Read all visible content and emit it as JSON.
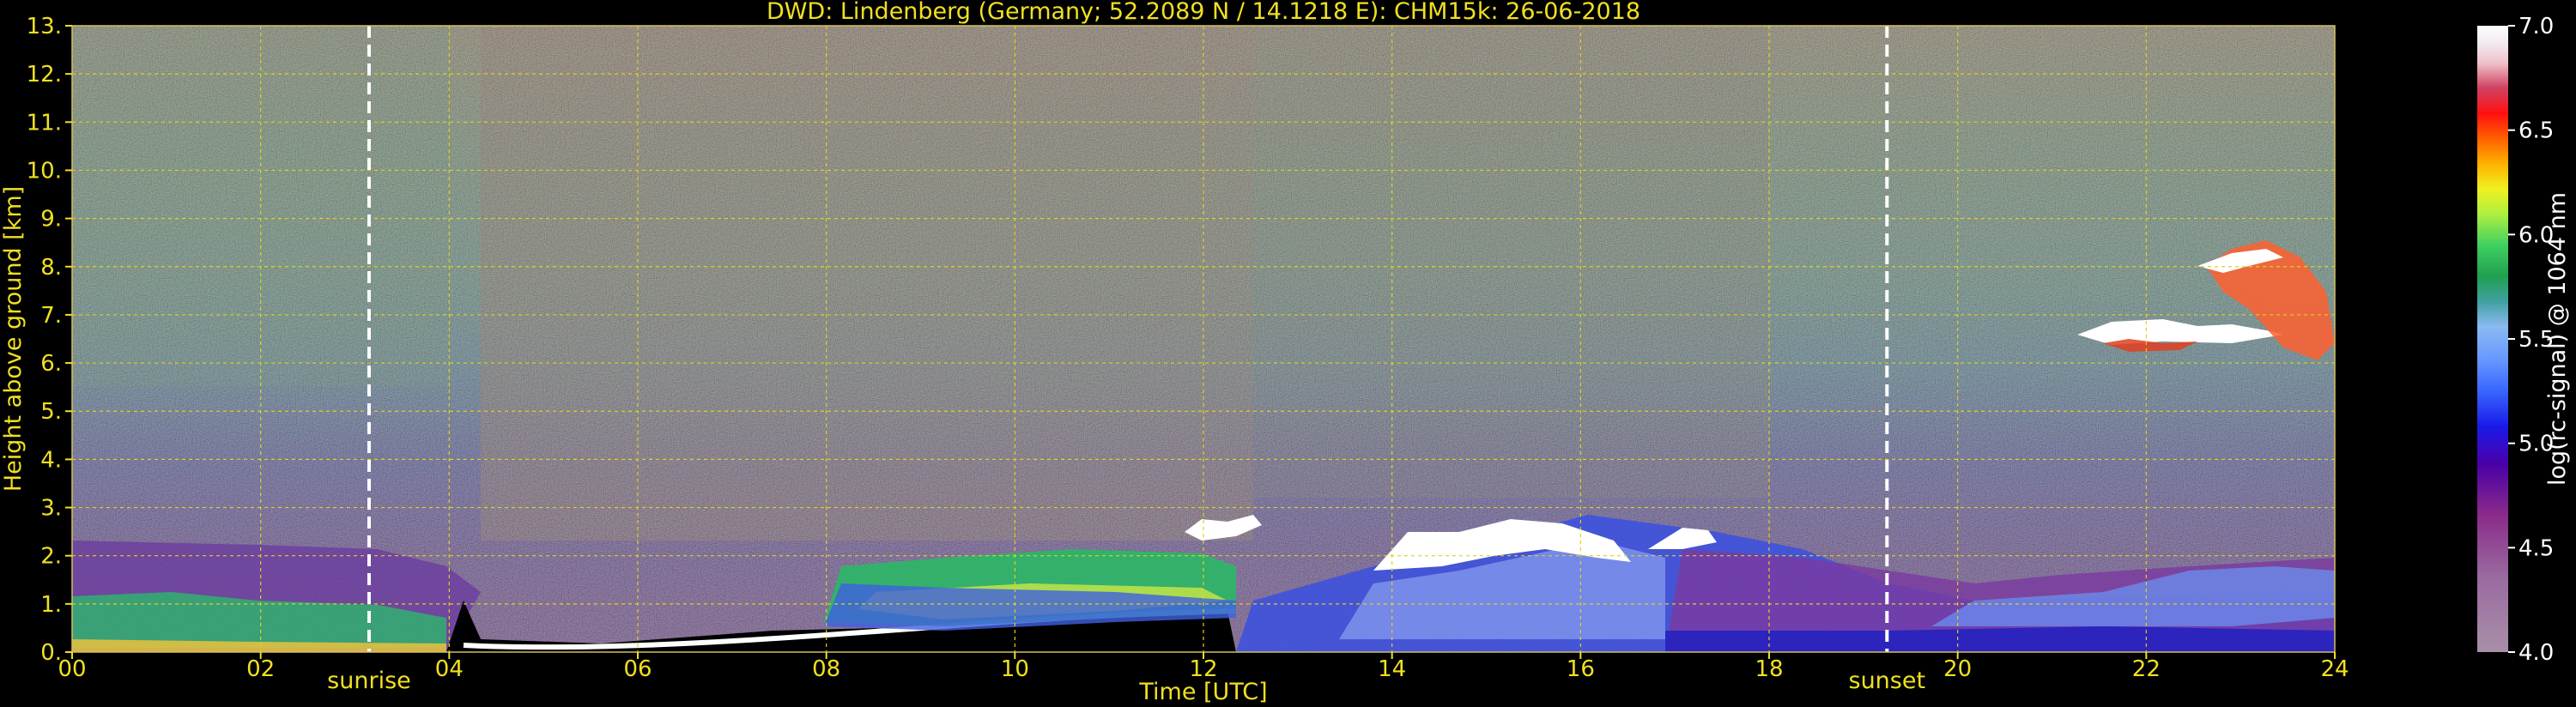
{
  "chart_data": {
    "type": "heatmap",
    "title": "DWD: Lindenberg (Germany; 52.2089 N / 14.1218 E):    CHM15k: 26-06-2018",
    "xlabel": "Time [UTC]",
    "ylabel": "Height above ground [km]",
    "xlim": [
      0,
      24
    ],
    "ylim": [
      0,
      13
    ],
    "x_ticks": [
      "00",
      "02",
      "04",
      "06",
      "08",
      "10",
      "12",
      "14",
      "16",
      "18",
      "20",
      "22",
      "24"
    ],
    "y_ticks": [
      "0.",
      "1.",
      "2.",
      "3.",
      "4.",
      "5.",
      "6.",
      "7.",
      "8.",
      "9.",
      "10.",
      "11.",
      "12.",
      "13."
    ],
    "grid": true,
    "colorbar": {
      "label": "log(rc-signal) @ 1064 nm",
      "range": [
        4.0,
        7.0
      ],
      "ticks": [
        "4.0",
        "4.5",
        "5.0",
        "5.5",
        "6.0",
        "6.5",
        "7.0"
      ]
    },
    "markers": [
      {
        "label": "sunrise",
        "x": 3.15
      },
      {
        "label": "sunset",
        "x": 19.25
      }
    ],
    "features": {
      "boundary_layer_top_km": [
        [
          0,
          1.2
        ],
        [
          2,
          1.1
        ],
        [
          3.5,
          1.0
        ],
        [
          4.3,
          0.1
        ],
        [
          6,
          0.2
        ],
        [
          8,
          0.6
        ],
        [
          10,
          1.0
        ],
        [
          12.3,
          1.1
        ],
        [
          13.8,
          1.1
        ],
        [
          15,
          1.3
        ],
        [
          16.8,
          1.2
        ],
        [
          20,
          1.0
        ],
        [
          22,
          1.4
        ],
        [
          24,
          1.7
        ]
      ],
      "clouds": [
        {
          "t_start": 11.7,
          "t_end": 12.5,
          "height_km": 2.3
        },
        {
          "t_start": 13.8,
          "t_end": 16.8,
          "height_km": 2.0
        },
        {
          "t_start": 20.4,
          "t_end": 23.9,
          "height_km": 6.6
        }
      ]
    }
  }
}
